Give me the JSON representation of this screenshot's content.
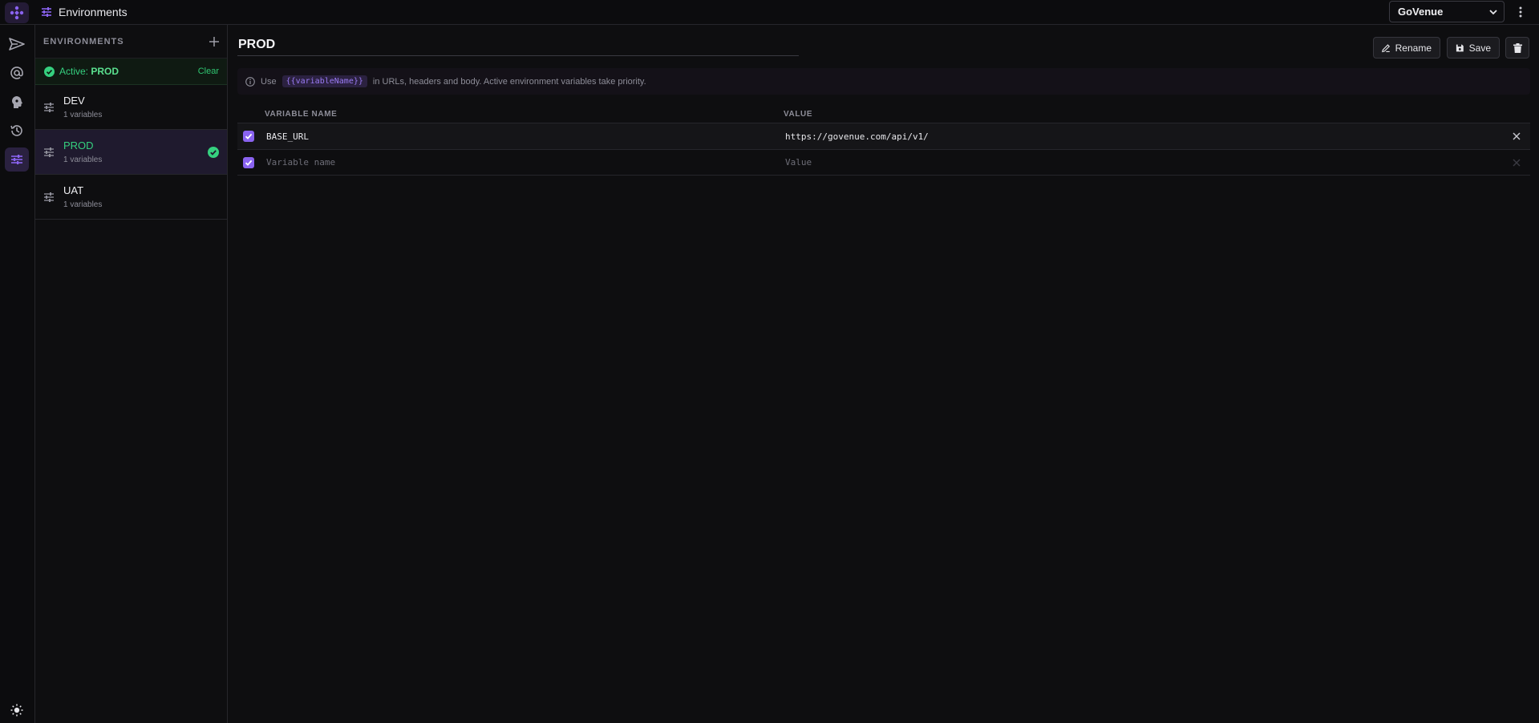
{
  "topbar": {
    "title": "Environments",
    "workspace_selected": "GoVenue"
  },
  "sidebar": {
    "title": "ENVIRONMENTS",
    "active": {
      "prefix": "Active: ",
      "env": "PROD",
      "clear_label": "Clear"
    },
    "environments": [
      {
        "name": "DEV",
        "count": "1 variables",
        "selected": false
      },
      {
        "name": "PROD",
        "count": "1 variables",
        "selected": true
      },
      {
        "name": "UAT",
        "count": "1 variables",
        "selected": false
      }
    ]
  },
  "main": {
    "env_name": "PROD",
    "buttons": {
      "rename": "Rename",
      "save": "Save"
    },
    "info": {
      "prefix": "Use",
      "code": "{{variableName}}",
      "suffix": "in URLs, headers and body. Active environment variables take priority."
    },
    "columns": {
      "name": "VARIABLE NAME",
      "value": "VALUE"
    },
    "variables": [
      {
        "name": "BASE_URL",
        "value": "https://govenue.com/api/v1/",
        "enabled": true
      }
    ],
    "new_row": {
      "name_placeholder": "Variable name",
      "value_placeholder": "Value",
      "enabled": true
    }
  },
  "colors": {
    "accent": "#8a63f0",
    "active_green": "#35d07f",
    "background": "#0e0e10"
  }
}
